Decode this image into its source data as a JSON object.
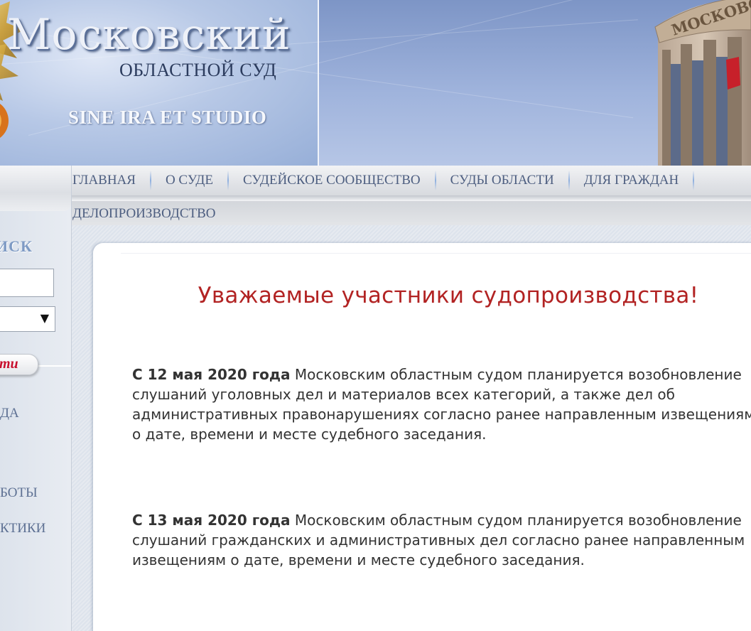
{
  "header": {
    "title": "Московский",
    "subtitle": "областной суд",
    "motto": "SINE IRA ET STUDIO",
    "building_sign": "МОСКОВСК"
  },
  "nav": {
    "items": [
      "ГЛАВНАЯ",
      "О СУДЕ",
      "СУДЕЙСКОЕ СООБЩЕСТВО",
      "СУДЫ ОБЛАСТИ",
      "ДЛЯ ГРАЖДАН"
    ],
    "row2": [
      "ДЕЛОПРОИЗВОДСТВО"
    ]
  },
  "sidebar": {
    "search_heading": "ИСК",
    "search_input_value": "",
    "search_select_value": "",
    "search_button_label": "ти",
    "links": [
      "ДА",
      "БОТЫ",
      "КТИКИ"
    ]
  },
  "content": {
    "title": "Уважаемые участники судопроизводства!",
    "paragraphs": [
      {
        "date": "С 12 мая 2020 года",
        "text": " Московским областным судом планируется возобновление слушаний уголовных дел и материалов всех категорий, а также дел об административных правонарушениях согласно ранее направленным извещениям о дате, времени и месте судебного заседания."
      },
      {
        "date": "С 13 мая 2020 года",
        "text": " Московским областным судом планируется возобновление слушаний гражданских и административных дел согласно ранее направленным извещениям о дате, времени и месте судебного заседания."
      }
    ]
  },
  "icons": {
    "emblem": "coat-of-arms-icon",
    "select_arrow": "triangle-down-icon",
    "building": "court-building-image"
  },
  "colors": {
    "title_red": "#b22323",
    "nav_text": "#4d5e80",
    "button_red": "#c8102e"
  }
}
